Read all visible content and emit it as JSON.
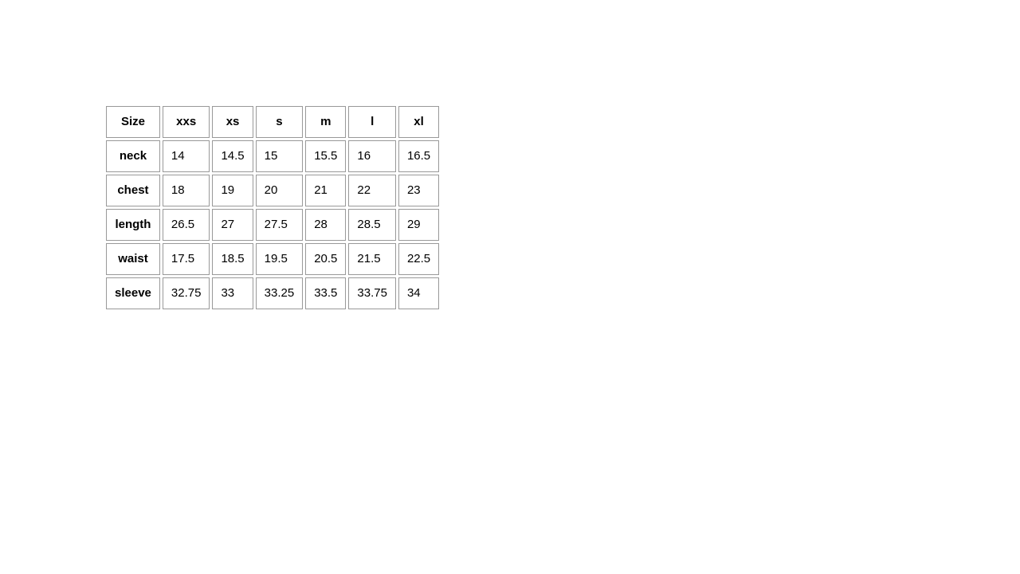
{
  "table": {
    "headers": [
      "Size",
      "xxs",
      "xs",
      "s",
      "m",
      "l",
      "xl"
    ],
    "rows": [
      {
        "label": "neck",
        "values": [
          "14",
          "14.5",
          "15",
          "15.5",
          "16",
          "16.5"
        ]
      },
      {
        "label": "chest",
        "values": [
          "18",
          "19",
          "20",
          "21",
          "22",
          "23"
        ]
      },
      {
        "label": "length",
        "values": [
          "26.5",
          "27",
          "27.5",
          "28",
          "28.5",
          "29"
        ]
      },
      {
        "label": "waist",
        "values": [
          "17.5",
          "18.5",
          "19.5",
          "20.5",
          "21.5",
          "22.5"
        ]
      },
      {
        "label": "sleeve",
        "values": [
          "32.75",
          "33",
          "33.25",
          "33.5",
          "33.75",
          "34"
        ]
      }
    ]
  }
}
